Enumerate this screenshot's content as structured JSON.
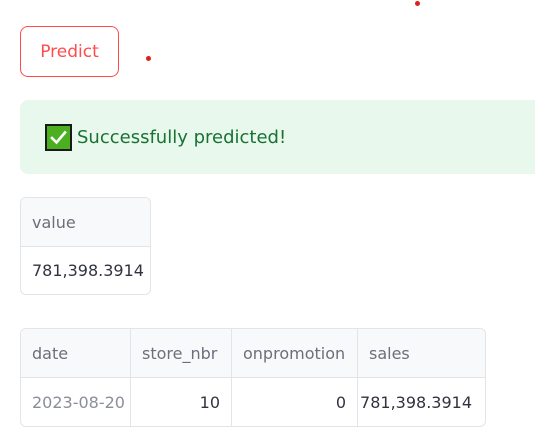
{
  "predict_button": {
    "label": "Predict"
  },
  "alert": {
    "icon": "check-mark-icon",
    "message": "Successfully predicted!",
    "background": "#e9f8ec",
    "text_color": "#177233"
  },
  "value_table": {
    "header": "value",
    "value": "781,398.3914"
  },
  "result_table": {
    "columns": [
      "date",
      "store_nbr",
      "onpromotion",
      "sales"
    ],
    "row": {
      "date": "2023-08-20",
      "store_nbr": "10",
      "onpromotion": "0",
      "sales": "781,398.3914"
    }
  },
  "colors": {
    "accent": "#ff4b4b",
    "indicator_dot": "#e0201b"
  }
}
